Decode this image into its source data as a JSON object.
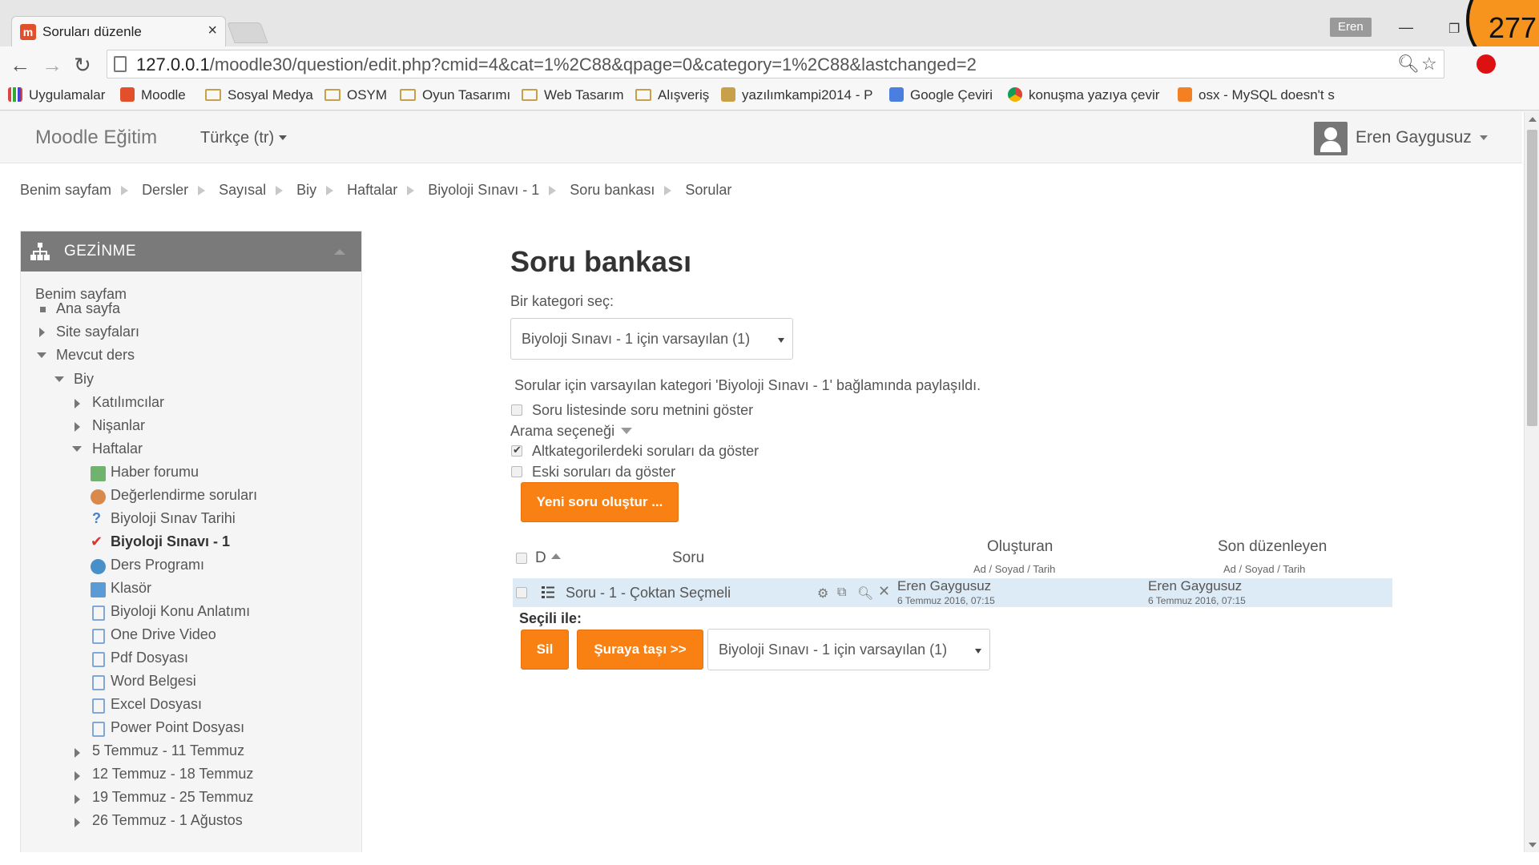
{
  "browser": {
    "tab_title": "Soruları düzenle",
    "tab_close": "×",
    "profile": "Eren",
    "badge": "277",
    "url_host": "127.0.0.1",
    "url_path": "/moodle30/question/edit.php?cmid=4&cat=1%2C88&qpage=0&category=1%2C88&lastchanged=2",
    "bookmarks": [
      {
        "label": "Uygulamalar",
        "icon": "apps-grid-icon"
      },
      {
        "label": "Moodle",
        "icon": "moodle-icon"
      },
      {
        "label": "Sosyal Medya",
        "icon": "folder-icon"
      },
      {
        "label": "OSYM",
        "icon": "folder-icon"
      },
      {
        "label": "Oyun Tasarımı",
        "icon": "folder-icon"
      },
      {
        "label": "Web Tasarım",
        "icon": "folder-icon"
      },
      {
        "label": "Alışveriş",
        "icon": "folder-icon"
      },
      {
        "label": "yazılımkampi2014 - P",
        "icon": "site-icon"
      },
      {
        "label": "Google Çeviri",
        "icon": "translate-icon"
      },
      {
        "label": "konuşma yazıya çevir",
        "icon": "chrome-icon"
      },
      {
        "label": "osx - MySQL doesn't s",
        "icon": "stackoverflow-icon"
      }
    ]
  },
  "navbar": {
    "brand": "Moodle Eğitim",
    "language": "Türkçe (tr)",
    "user": "Eren Gaygusuz"
  },
  "breadcrumb": [
    "Benim sayfam",
    "Dersler",
    "Sayısal",
    "Biy",
    "Haftalar",
    "Biyoloji Sınavı - 1",
    "Soru bankası",
    "Sorular"
  ],
  "nav_block": {
    "title": "GEZİNME",
    "items": {
      "my_page": "Benim sayfam",
      "home": "Ana sayfa",
      "site_pages": "Site sayfaları",
      "current_course": "Mevcut ders",
      "course": "Biy",
      "participants": "Katılımcılar",
      "badges": "Nişanlar",
      "weeks": "Haftalar",
      "activities": [
        "Haber forumu",
        "Değerlendirme soruları",
        "Biyoloji Sınav Tarihi",
        "Biyoloji Sınavı - 1",
        "Ders Programı",
        "Klasör",
        "Biyoloji Konu Anlatımı",
        "One Drive Video",
        "Pdf Dosyası",
        "Word Belgesi",
        "Excel Dosyası",
        "Power Point Dosyası"
      ],
      "week_sections": [
        "5 Temmuz - 11 Temmuz",
        "12 Temmuz - 18 Temmuz",
        "19 Temmuz - 25 Temmuz",
        "26 Temmuz - 1 Ağustos"
      ]
    }
  },
  "main": {
    "title": "Soru bankası",
    "category_label": "Bir kategori seç:",
    "category_value": "Biyoloji Sınavı - 1 için varsayılan (1)",
    "shared_info": "Sorular için varsayılan kategori 'Biyoloji Sınavı - 1' bağlamında paylaşıldı.",
    "show_text_option": "Soru listesinde soru metnini göster",
    "search_options": "Arama seçeneği",
    "subcategories_option": "Altkategorilerdeki soruları da göster",
    "old_questions_option": "Eski soruları da göster",
    "create_button": "Yeni soru oluştur ...",
    "table": {
      "col_type": "D",
      "col_question": "Soru",
      "col_created": "Oluşturan",
      "col_created_sub": "Ad / Soyad / Tarih",
      "col_modified": "Son düzenleyen",
      "col_modified_sub": "Ad / Soyad / Tarih",
      "rows": [
        {
          "name": "Soru - 1 - Çoktan Seçmeli",
          "created_by": "Eren Gaygusuz",
          "created_date": "6 Temmuz 2016, 07:15",
          "modified_by": "Eren Gaygusuz",
          "modified_date": "6 Temmuz 2016, 07:15"
        }
      ]
    },
    "with_selected": "Seçili ile:",
    "delete_button": "Sil",
    "move_button": "Şuraya taşı >>",
    "move_target": "Biyoloji Sınavı - 1 için varsayılan (1)"
  },
  "colors": {
    "accent": "#f98012",
    "nav_header": "#7a7a7a",
    "row_highlight": "#dcebf5"
  }
}
